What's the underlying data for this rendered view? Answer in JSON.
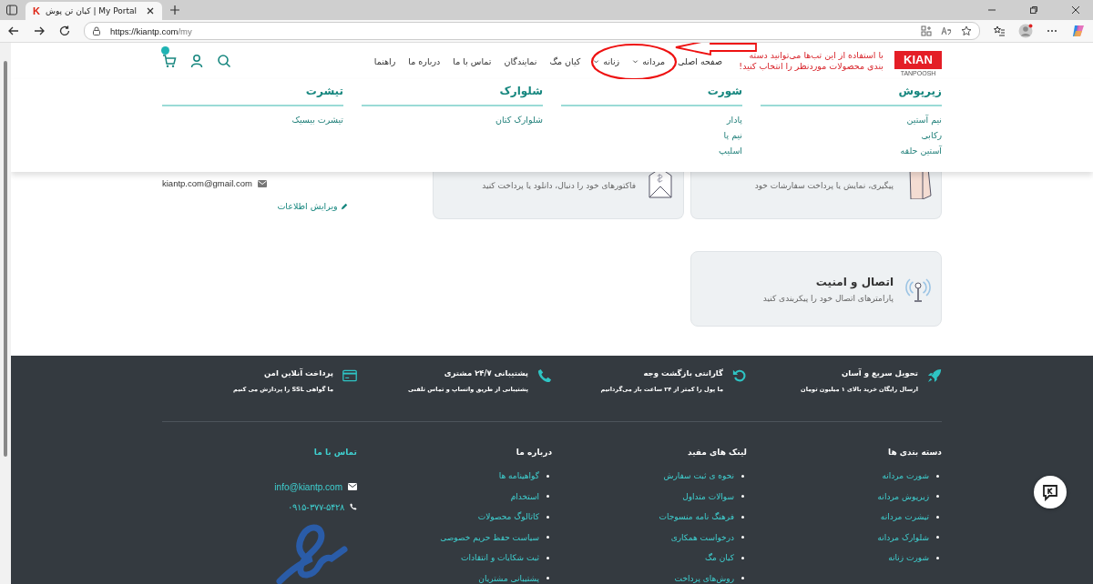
{
  "browser": {
    "favicon": "K",
    "tab_title": "کیان تن پوش | My Portal",
    "url_host": "https://kiantp.com",
    "url_path": "/my"
  },
  "site_header": {
    "logo": {
      "text": "KIAN",
      "subtext": "TANPOOSH"
    },
    "nav": [
      {
        "label": "صفحه اصلی",
        "dropdown": false
      },
      {
        "label": "مردانه",
        "dropdown": true
      },
      {
        "label": "زنانه",
        "dropdown": true
      },
      {
        "label": "کیان مگ",
        "dropdown": false
      },
      {
        "label": "نمایندگان",
        "dropdown": false
      },
      {
        "label": "تماس با ما",
        "dropdown": false
      },
      {
        "label": "درباره ما",
        "dropdown": false
      },
      {
        "label": "راهنما",
        "dropdown": false
      }
    ]
  },
  "annotation": {
    "text": "با استفاده از این تب‌ها می‌توانید دسته بندی محصولات موردنظر را انتخاب کنید!"
  },
  "mega_menu": [
    {
      "title": "زیرپوش",
      "items": [
        "نیم آستین",
        "رکابی",
        "آستین حلقه"
      ]
    },
    {
      "title": "شورت",
      "items": [
        "پادار",
        "نیم پا",
        "اسلیپ"
      ]
    },
    {
      "title": "شلوارک",
      "items": [
        "شلوارک کتان"
      ]
    },
    {
      "title": "تیشرت",
      "items": [
        "تیشرت بیسیک"
      ]
    }
  ],
  "account": {
    "email": "kiantp.com@gmail.com",
    "edit_link": "ویرایش اطلاعات",
    "cards": [
      {
        "kind": "bag",
        "description": "پیگیری، نمایش یا پرداخت سفارشات خود"
      },
      {
        "kind": "invoice",
        "description": "فاکتورهای خود را دنبال، دانلود یا پرداخت کنید"
      }
    ],
    "security_card": {
      "kind": "signal",
      "title": "اتصال و امنیت",
      "description": "پارامترهای اتصال خود را پیکربندی کنید"
    }
  },
  "footer": {
    "features": [
      {
        "kind": "rocket",
        "title": "تحویل سریع و آسان",
        "subtitle": "ارسال رایگان خرید بالای ۱ میلیون تومان"
      },
      {
        "kind": "refresh",
        "title": "گارانتی بازگشت وجه",
        "subtitle": "ما پول را کمتر از ۲۴ ساعت باز می‌گردانیم"
      },
      {
        "kind": "phone",
        "title": "پشتیبانی ۲۴/۷ مشتری",
        "subtitle": "پشتیبانی از طریق واتساپ و تماس تلفنی"
      },
      {
        "kind": "card",
        "title": "پرداخت آنلاین امن",
        "subtitle": "ما گواهی SSL را پردازش می کنیم"
      }
    ],
    "columns": [
      {
        "title": "دسته بندی ها",
        "links": [
          "شورت مردانه",
          "زیرپوش مردانه",
          "تیشرت مردانه",
          "شلوارک مردانه",
          "شورت زنانه"
        ]
      },
      {
        "title": "لینک های مفید",
        "links": [
          "نحوه ی ثبت سفارش",
          "سوالات متداول",
          "فرهنگ نامه منسوجات",
          "درخواست همکاری",
          "کیان مگ",
          "روش‌های پرداخت"
        ]
      },
      {
        "title": "درباره ما",
        "links": [
          "گواهینامه ها",
          "استخدام",
          "کاتالوگ محصولات",
          "سیاست حفظ حریم خصوصی",
          "ثبت شکایات و انتقادات",
          "پشتیبانی مشتریان"
        ]
      }
    ],
    "contact": {
      "title": "تماس با ما",
      "email": "info@kiantp.com",
      "phone": "۰۹۱۵-۳۷۷-۵۴۲۸"
    }
  }
}
